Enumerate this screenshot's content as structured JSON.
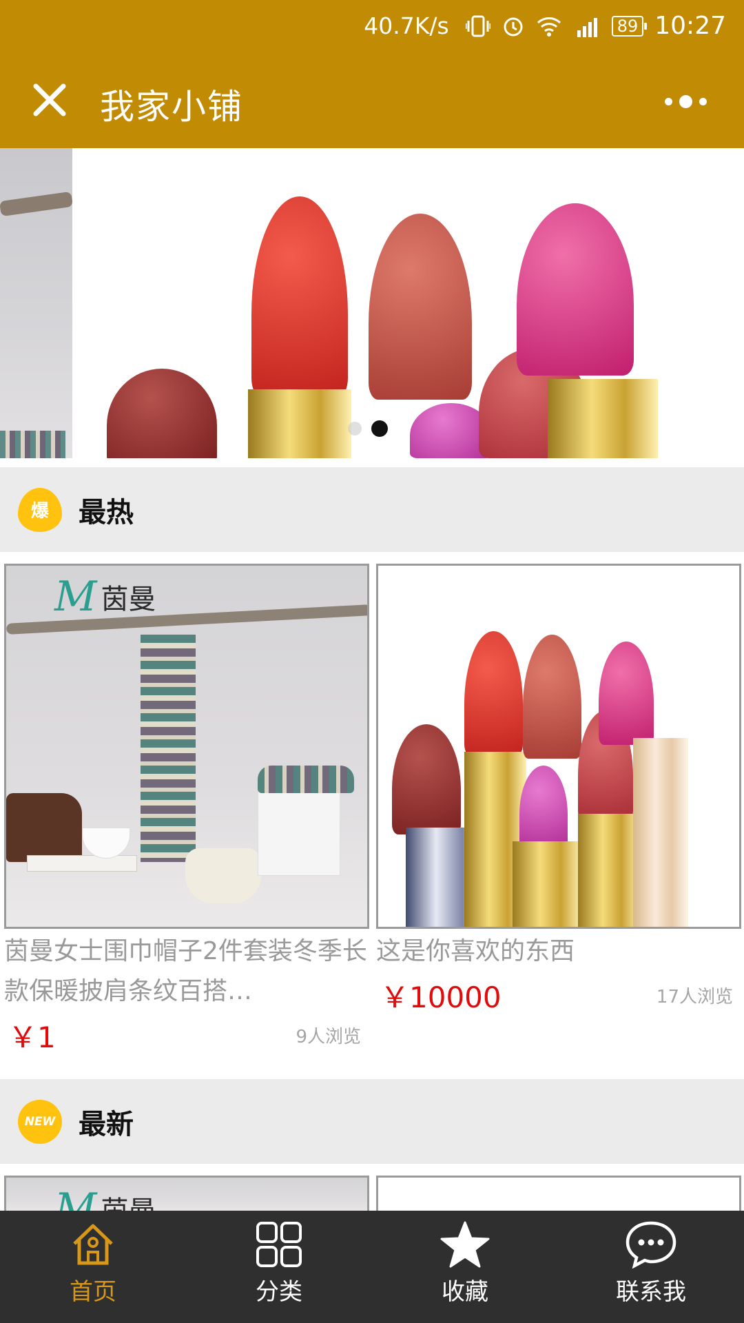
{
  "status_bar": {
    "net_speed": "40.7K/s",
    "battery": "89",
    "time": "10:27"
  },
  "header": {
    "title": "我家小铺"
  },
  "sections": {
    "hot": {
      "badge": "爆",
      "title": "最热"
    },
    "new": {
      "badge": "NEW",
      "title": "最新"
    }
  },
  "hot_products": [
    {
      "name": "茵曼女士围巾帽子2件套装冬季长款保暖披肩条纹百搭…",
      "price": "￥1",
      "views": "9人浏览"
    },
    {
      "name": "这是你喜欢的东西",
      "price": "￥10000",
      "views": "17人浏览"
    }
  ],
  "brand_logo": "茵曼",
  "tabbar": [
    {
      "label": "首页",
      "icon": "home-icon"
    },
    {
      "label": "分类",
      "icon": "grid-icon"
    },
    {
      "label": "收藏",
      "icon": "star-icon"
    },
    {
      "label": "联系我",
      "icon": "chat-icon"
    }
  ],
  "colors": {
    "accent": "#c28b04",
    "price": "#e10b0b",
    "tab_active": "#d7981a",
    "badge": "#ffc20e"
  }
}
